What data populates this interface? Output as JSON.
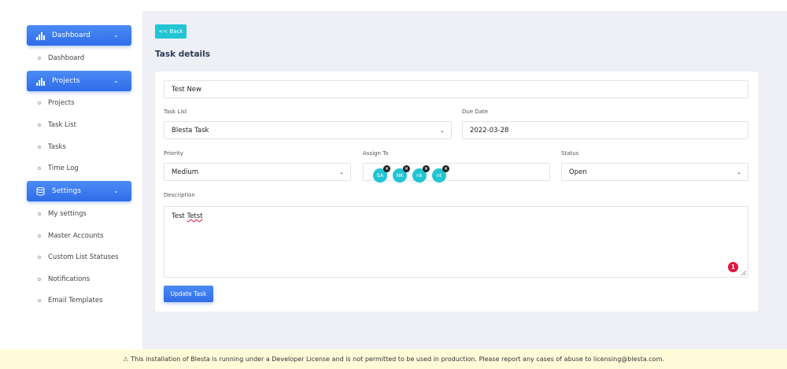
{
  "sidebar": {
    "dashboard_header": "Dashboard",
    "dashboard_items": [
      "Dashboard"
    ],
    "projects_header": "Projects",
    "projects_items": [
      "Projects",
      "Task List",
      "Tasks",
      "Time Log"
    ],
    "settings_header": "Settings",
    "settings_items": [
      "My settings",
      "Master Accounts",
      "Custom List Statuses",
      "Notifications",
      "Email Templates"
    ]
  },
  "header": {
    "back_label": "<< Back",
    "title": "Task details"
  },
  "form": {
    "task_name": "Test New",
    "task_list_label": "Task List",
    "task_list_value": "Blesta Task",
    "due_date_label": "Due Date",
    "due_date_value": "2022-03-28",
    "priority_label": "Priority",
    "priority_value": "Medium",
    "assign_label": "Assign To",
    "assignees": [
      "SA",
      "NK",
      "nk",
      "nt"
    ],
    "status_label": "Status",
    "status_value": "Open",
    "description_label": "Description",
    "description_word1": "Test",
    "description_word2": "Tetst",
    "error_count": "1",
    "update_label": "Update Task"
  },
  "footer": {
    "notice": "This installation of Blesta is running under a Developer License and is not permitted to be used in production. Please report any cases of abuse to licensing@blesta.com."
  },
  "colors": {
    "primary": "#2f6de8",
    "accent": "#21c5d4",
    "error": "#e3143c",
    "background": "#eef0f6",
    "footer_bg": "#fffbd9"
  }
}
